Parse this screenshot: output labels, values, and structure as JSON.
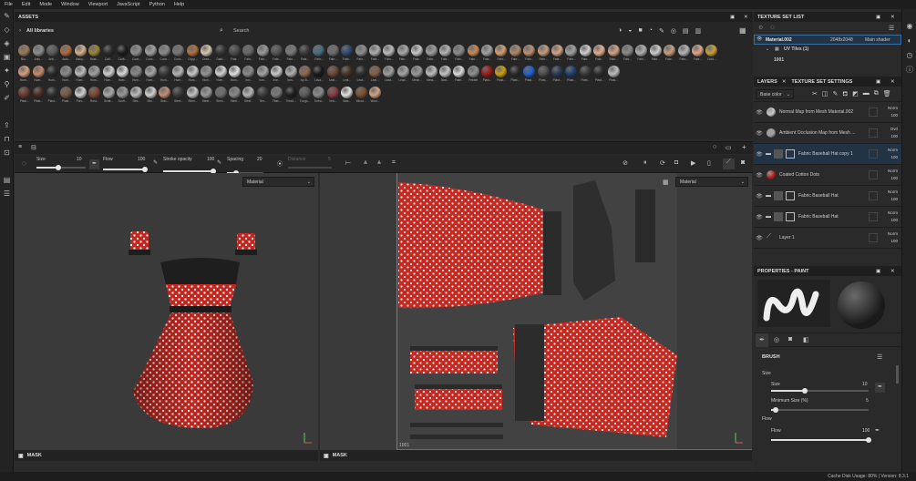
{
  "menu": [
    "File",
    "Edit",
    "Mode",
    "Window",
    "Viewport",
    "JavaScript",
    "Python",
    "Help"
  ],
  "assets": {
    "title": "ASSETS",
    "library": "All libraries",
    "search_placeholder": "Search",
    "rows": [
      [
        {
          "l": "Blu...",
          "c": "#9a7a5a"
        },
        {
          "l": "Anis...",
          "c": "#8c8c8c"
        },
        {
          "l": "Anti...",
          "c": "#5b5b5b"
        },
        {
          "l": "Auto...",
          "c": "#b06a45"
        },
        {
          "l": "Baby...",
          "c": "#d7b08c"
        },
        {
          "l": "Bras...",
          "c": "#9b8440"
        },
        {
          "l": "Calf...",
          "c": "#2b2b2b"
        },
        {
          "l": "Carb...",
          "c": "#1c1c1c"
        },
        {
          "l": "Coat...",
          "c": "#909090"
        },
        {
          "l": "Conc...",
          "c": "#a0a0a0"
        },
        {
          "l": "Conc...",
          "c": "#8a8a8a"
        },
        {
          "l": "Conc...",
          "c": "#777"
        },
        {
          "l": "Copp...",
          "c": "#b07040"
        },
        {
          "l": "Crea...",
          "c": "#d4c7b0"
        },
        {
          "l": "Dark...",
          "c": "#333"
        },
        {
          "l": "Fabr...",
          "c": "#4a4a4a"
        },
        {
          "l": "Fabr...",
          "c": "#666"
        },
        {
          "l": "Fabr...",
          "c": "#999"
        },
        {
          "l": "Fabr...",
          "c": "#555"
        },
        {
          "l": "Fabr...",
          "c": "#7a7a7a"
        },
        {
          "l": "Fabr...",
          "c": "#3a3a3a"
        },
        {
          "l": "Fabr...",
          "c": "#4c6b80"
        },
        {
          "l": "Fabr...",
          "c": "#6d6d6d"
        },
        {
          "l": "Fabr...",
          "c": "#2e4a70"
        },
        {
          "l": "Fabr...",
          "c": "#8f8f8f"
        },
        {
          "l": "Fabr...",
          "c": "#adadad"
        },
        {
          "l": "Fabr...",
          "c": "#bbb"
        },
        {
          "l": "Fabr...",
          "c": "#a9a9a9"
        },
        {
          "l": "Fabr...",
          "c": "#c8c8c8"
        },
        {
          "l": "Fabr...",
          "c": "#9d9d9d"
        },
        {
          "l": "Fabr...",
          "c": "#b5b5b5"
        },
        {
          "l": "Fabr...",
          "c": "#8b8b8b"
        },
        {
          "l": "Fabr...",
          "c": "#c58a5a"
        },
        {
          "l": "Fabr...",
          "c": "#a3a3a3"
        },
        {
          "l": "Fabr...",
          "c": "#d0a070"
        },
        {
          "l": "Fabr...",
          "c": "#ae8a68"
        },
        {
          "l": "Fabr...",
          "c": "#bf8f70"
        },
        {
          "l": "Fabr...",
          "c": "#c79d7c"
        },
        {
          "l": "Fabr...",
          "c": "#d2a486"
        },
        {
          "l": "Fabr...",
          "c": "#a1a1a1"
        },
        {
          "l": "Fabr...",
          "c": "#cfcfcf"
        },
        {
          "l": "Fabr...",
          "c": "#e0b090"
        },
        {
          "l": "Fabr...",
          "c": "#d4a383"
        },
        {
          "l": "Fabr...",
          "c": "#8a8a8a"
        },
        {
          "l": "Fabr...",
          "c": "#b0b0b0"
        },
        {
          "l": "Fabr...",
          "c": "#ccc"
        },
        {
          "l": "Fabr...",
          "c": "#c9a080"
        },
        {
          "l": "Fabr...",
          "c": "#b5b5b5"
        },
        {
          "l": "Fabr...",
          "c": "#e0a585"
        },
        {
          "l": "Gold...",
          "c": "#c8a040"
        }
      ],
      [
        {
          "l": "Hum...",
          "c": "#d69d7e"
        },
        {
          "l": "Hum...",
          "c": "#c98a6b"
        },
        {
          "l": "Hum...",
          "c": "#2a2a2a"
        },
        {
          "l": "Hum...",
          "c": "#8c8c8c"
        },
        {
          "l": "Hum...",
          "c": "#bbbbbb"
        },
        {
          "l": "Hum...",
          "c": "#a0a0a0"
        },
        {
          "l": "Hum...",
          "c": "#cfcfcf"
        },
        {
          "l": "Hum...",
          "c": "#d8d8d8"
        },
        {
          "l": "Hum...",
          "c": "#888"
        },
        {
          "l": "Hum...",
          "c": "#a6a6a6"
        },
        {
          "l": "Hum...",
          "c": "#3a3a3a"
        },
        {
          "l": "Hum...",
          "c": "#b5b5b5"
        },
        {
          "l": "Hum...",
          "c": "#c7c7c7"
        },
        {
          "l": "Hum...",
          "c": "#949494"
        },
        {
          "l": "Hum...",
          "c": "#d2d2d2"
        },
        {
          "l": "Hum...",
          "c": "#e0e0e0"
        },
        {
          "l": "Iron...",
          "c": "#8a8a8a"
        },
        {
          "l": "Iron...",
          "c": "#a3a3a3"
        },
        {
          "l": "Iron...",
          "c": "#cacaca"
        },
        {
          "l": "Iron...",
          "c": "#b0b0b0"
        },
        {
          "l": "Ivy B...",
          "c": "#8a6a50"
        },
        {
          "l": "Lava...",
          "c": "#1a1a1a"
        },
        {
          "l": "Leat...",
          "c": "#6b4a35"
        },
        {
          "l": "Leat...",
          "c": "#4a3325"
        },
        {
          "l": "Leat...",
          "c": "#2d2d2d"
        },
        {
          "l": "Leat...",
          "c": "#855e44"
        },
        {
          "l": "Lead...",
          "c": "#9c9c9c"
        },
        {
          "l": "Lead...",
          "c": "#a5a5a5"
        },
        {
          "l": "Mech...",
          "c": "#9a9a9a"
        },
        {
          "l": "Meta...",
          "c": "#bdbdbd"
        },
        {
          "l": "Nick...",
          "c": "#c4c4c4"
        },
        {
          "l": "Paint...",
          "c": "#dadada"
        },
        {
          "l": "Pebble",
          "c": "#8f8f8f"
        },
        {
          "l": "Plast...",
          "c": "#9e1a1a"
        },
        {
          "l": "Plast...",
          "c": "#c9a014"
        },
        {
          "l": "Plast...",
          "c": "#2a2a2a"
        },
        {
          "l": "Plast...",
          "c": "#1f5fd0"
        },
        {
          "l": "Plast...",
          "c": "#4d4d4d"
        },
        {
          "l": "Plast...",
          "c": "#2a3a55"
        },
        {
          "l": "Plast...",
          "c": "#1f3f70"
        },
        {
          "l": "Plast...",
          "c": "#3a3a3a"
        },
        {
          "l": "Plast...",
          "c": "#2c2c2c"
        },
        {
          "l": "Plast...",
          "c": "#bdbdbd"
        }
      ],
      [
        {
          "l": "Plast...",
          "c": "#6a3a2a"
        },
        {
          "l": "Plast...",
          "c": "#4a2a1e"
        },
        {
          "l": "Plast...",
          "c": "#2d2d2d"
        },
        {
          "l": "Plast...",
          "c": "#7a5a45"
        },
        {
          "l": "Porc...",
          "c": "#d0d0d0"
        },
        {
          "l": "Rust...",
          "c": "#7a4a30"
        },
        {
          "l": "Scrat...",
          "c": "#aaa"
        },
        {
          "l": "Scuff...",
          "c": "#999"
        },
        {
          "l": "Silic...",
          "c": "#bcbcbc"
        },
        {
          "l": "Silv...",
          "c": "#cfcfcf"
        },
        {
          "l": "Skin...",
          "c": "#c28f75"
        },
        {
          "l": "Steel...",
          "c": "#3a3a3a"
        },
        {
          "l": "Steel...",
          "c": "#c2c2c2"
        },
        {
          "l": "Steel...",
          "c": "#9a9a9a"
        },
        {
          "l": "Steel...",
          "c": "#6e6e6e"
        },
        {
          "l": "Steel...",
          "c": "#8a8a8a"
        },
        {
          "l": "Steel...",
          "c": "#b4b4b4"
        },
        {
          "l": "Terr...",
          "c": "#3a3a3a"
        },
        {
          "l": "Titan...",
          "c": "#7a7a7a"
        },
        {
          "l": "Tread...",
          "c": "#1e1e1e"
        },
        {
          "l": "Tungs...",
          "c": "#5a5a5a"
        },
        {
          "l": "Turbo...",
          "c": "#8a8a8a"
        },
        {
          "l": "Velv...",
          "c": "#8a3a40"
        },
        {
          "l": "Wax...",
          "c": "#e0e0e0"
        },
        {
          "l": "Wood...",
          "c": "#7a5030"
        },
        {
          "l": "Wool...",
          "c": "#d4a283"
        }
      ]
    ]
  },
  "brushbar": {
    "size_label": "Size",
    "size_value": "10",
    "size_frac": 0.45,
    "flow_label": "Flow",
    "flow_value": "100",
    "flow_frac": 1,
    "stroke_label": "Stroke opacity",
    "stroke_value": "100",
    "stroke_frac": 1,
    "spacing_label": "Spacing",
    "spacing_value": "20",
    "spacing_frac": 0.25,
    "distance_label": "Distance",
    "distance_value": "5"
  },
  "viewport3d": {
    "mode": "Material",
    "footer": "MASK"
  },
  "viewport2d": {
    "mode": "Material",
    "footer": "MASK",
    "uv_tile": "1001"
  },
  "texture_set_list": {
    "title": "TEXTURE SET LIST",
    "material": "Material.002",
    "resolution": "2048x2048",
    "shader": "Main shader",
    "uv_tiles": "UV Tiles (1)",
    "tile": "1001"
  },
  "layers_panel": {
    "tab_layers": "LAYERS",
    "tab_settings": "TEXTURE SET SETTINGS",
    "channel": "Base color",
    "layers": [
      {
        "name": "Normal Map from Mesh Material.002",
        "blend": "Norm",
        "opacity": "100",
        "thumb": "#c8c8c8",
        "kind": "sphere"
      },
      {
        "name": "Ambient Occlusion Map from Mesh ...",
        "blend": "Ovrl",
        "opacity": "100",
        "thumb": "#a0a0a0",
        "kind": "sphere"
      },
      {
        "name": "Fabric Baseball Hat copy 1",
        "blend": "Norm",
        "opacity": "100",
        "thumb": "#555",
        "kind": "folder"
      },
      {
        "name": "Coated Cotton Dots",
        "blend": "Norm",
        "opacity": "100",
        "thumb": "#b8221f",
        "kind": "sphere"
      },
      {
        "name": "Fabric Baseball Hat",
        "blend": "Norm",
        "opacity": "100",
        "thumb": "#555",
        "kind": "folder"
      },
      {
        "name": "Fabric Baseball Hat",
        "blend": "Norm",
        "opacity": "100",
        "thumb": "#555",
        "kind": "folder"
      },
      {
        "name": "Layer 1",
        "blend": "Norm",
        "opacity": "100",
        "thumb": "#333",
        "kind": "paint"
      }
    ]
  },
  "properties": {
    "title": "PROPERTIES - PAINT",
    "section": "BRUSH",
    "size_group": "Size",
    "size_label": "Size",
    "size_value": "10",
    "size_frac": 0.35,
    "min_size_label": "Minimum Size (%)",
    "min_size_value": "5",
    "min_size_frac": 0.05,
    "flow_group": "Flow",
    "flow_label": "Flow",
    "flow_value": "100",
    "flow_frac": 1
  },
  "status": "Cache Disk Usage:  80% | Version: 8.3.1"
}
